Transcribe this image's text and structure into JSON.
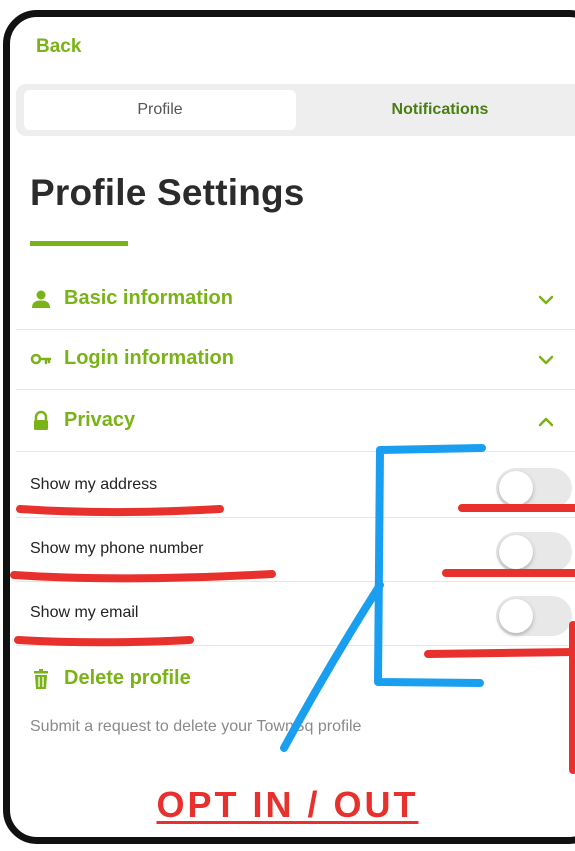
{
  "nav": {
    "back_label": "Back"
  },
  "tabs": [
    {
      "label": "Profile",
      "selected": true
    },
    {
      "label": "Notifications",
      "selected": false
    }
  ],
  "page_title": "Profile Settings",
  "sections": [
    {
      "label": "Basic information",
      "icon": "person-icon",
      "expanded": false
    },
    {
      "label": "Login information",
      "icon": "key-icon",
      "expanded": false
    },
    {
      "label": "Privacy",
      "icon": "lock-icon",
      "expanded": true
    }
  ],
  "privacy_options": [
    {
      "label": "Show my address",
      "enabled": false
    },
    {
      "label": "Show my phone number",
      "enabled": false
    },
    {
      "label": "Show my email",
      "enabled": false
    }
  ],
  "delete": {
    "label": "Delete profile",
    "icon": "trash-icon",
    "description": "Submit a request to delete your TownSq profile"
  },
  "annotation": {
    "text": "OPT IN / OUT"
  },
  "colors": {
    "accent": "#7ab317",
    "accent_dark": "#4a7d12",
    "annotation_red": "#e8302c",
    "annotation_blue": "#1a9ff0"
  }
}
